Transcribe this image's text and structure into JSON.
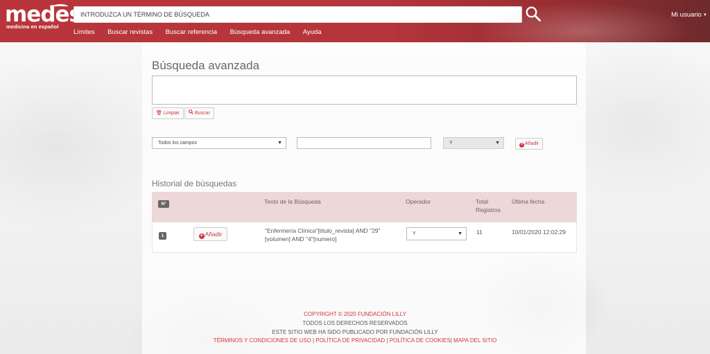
{
  "header": {
    "logo_text": "medes",
    "logo_tagline": "medicina en español",
    "search_placeholder": "INTRODUZCA UN TÉRMINO DE BÚSQUEDA",
    "user_menu": "Mi usuario",
    "nav": [
      "Límites",
      "Buscar revistas",
      "Buscar referencia",
      "Búsqueda avanzada",
      "Ayuda"
    ]
  },
  "main": {
    "title": "Búsqueda avanzada",
    "clear_label": "Limpiar",
    "search_label": "Buscar",
    "field_select": "Todos los campos",
    "operator_select": "Y",
    "add_label": "Añadir"
  },
  "history": {
    "title": "Historial de búsquedas",
    "headers": {
      "num": "Nº",
      "text": "Texto de la Búsqueda",
      "operator": "Operador",
      "total": "Total Registros",
      "date": "Última fecha"
    },
    "rows": [
      {
        "num": "1",
        "add_label": "Añadir",
        "text": "\"Enfermería Clínica\"[titulo_revista] AND \"29\" [volumen] AND \"4\"[numero]",
        "operator": "Y",
        "total": "11",
        "date": "10/01/2020 12:02:29"
      }
    ]
  },
  "footer": {
    "copyright": "COPYRIGHT © 2020 FUNDACIÓN LILLY",
    "rights": "TODOS LOS DERECHOS RESERVADOS",
    "published": "ESTE SITIO WEB HA SIDO PUBLICADO POR FUNDACIÓN LILLY",
    "links": [
      "TÉRMINOS Y CONDICIONES DE USO",
      "POLÍTICA DE PRIVACIDAD",
      "POLÍTICA DE COOKIES",
      "MAPA DEL SITIO"
    ]
  },
  "colors": {
    "brand_red": "#b9353b",
    "accent_red": "#c43a40",
    "table_header": "#edd7d8"
  }
}
